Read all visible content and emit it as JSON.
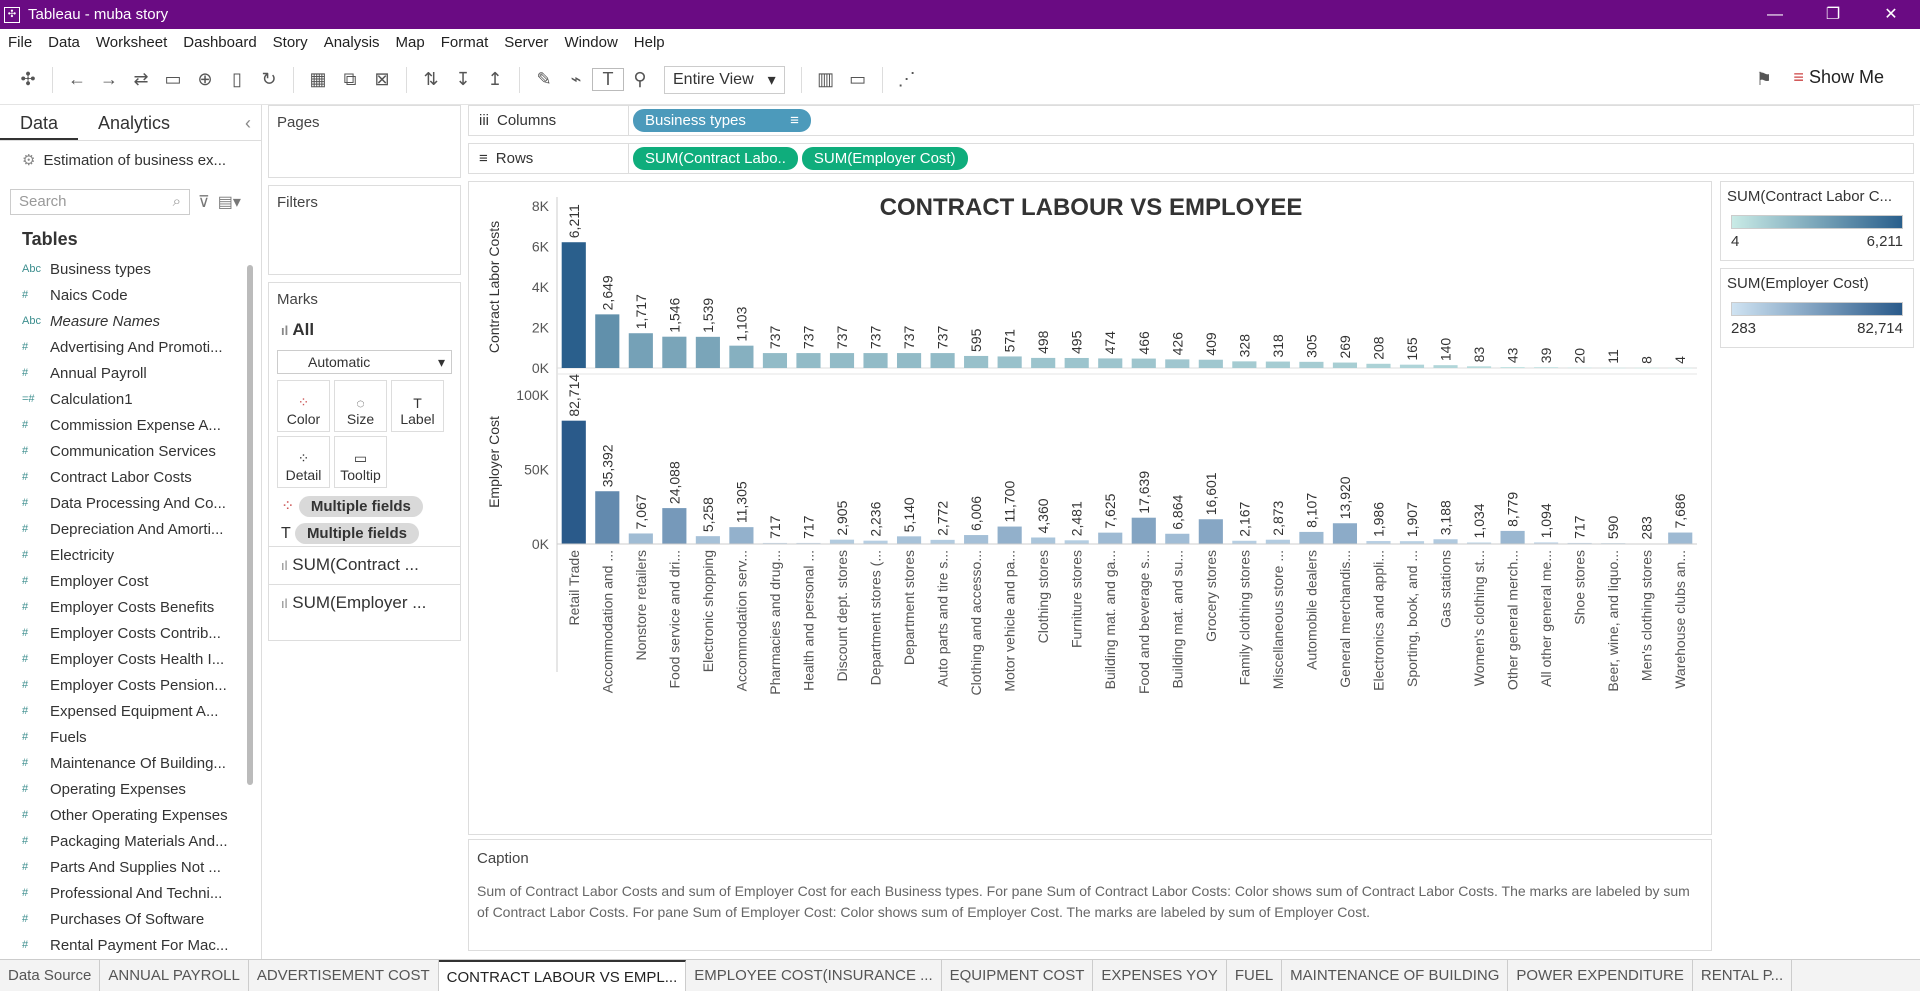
{
  "window": {
    "title": "Tableau - muba story"
  },
  "menu": [
    "File",
    "Data",
    "Worksheet",
    "Dashboard",
    "Story",
    "Analysis",
    "Map",
    "Format",
    "Server",
    "Window",
    "Help"
  ],
  "toolbar": {
    "fit": "Entire View",
    "showme": "Show Me"
  },
  "left": {
    "tabs": [
      "Data",
      "Analytics"
    ],
    "datasource": "Estimation of business ex...",
    "search_placeholder": "Search",
    "tables_heading": "Tables",
    "fields": [
      {
        "icon": "Abc",
        "label": "Business types"
      },
      {
        "icon": "#",
        "label": "Naics Code"
      },
      {
        "icon": "Abc",
        "label": "Measure Names",
        "italic": true
      },
      {
        "icon": "#",
        "label": "Advertising And Promoti..."
      },
      {
        "icon": "#",
        "label": "Annual Payroll"
      },
      {
        "icon": "=#",
        "label": "Calculation1"
      },
      {
        "icon": "#",
        "label": "Commission Expense A..."
      },
      {
        "icon": "#",
        "label": "Communication Services"
      },
      {
        "icon": "#",
        "label": "Contract Labor Costs"
      },
      {
        "icon": "#",
        "label": "Data Processing And Co..."
      },
      {
        "icon": "#",
        "label": "Depreciation And Amorti..."
      },
      {
        "icon": "#",
        "label": "Electricity"
      },
      {
        "icon": "#",
        "label": "Employer Cost"
      },
      {
        "icon": "#",
        "label": "Employer Costs Benefits"
      },
      {
        "icon": "#",
        "label": "Employer Costs Contrib..."
      },
      {
        "icon": "#",
        "label": "Employer Costs Health I..."
      },
      {
        "icon": "#",
        "label": "Employer Costs Pension..."
      },
      {
        "icon": "#",
        "label": "Expensed Equipment A..."
      },
      {
        "icon": "#",
        "label": "Fuels"
      },
      {
        "icon": "#",
        "label": "Maintenance Of Building..."
      },
      {
        "icon": "#",
        "label": "Operating Expenses"
      },
      {
        "icon": "#",
        "label": "Other Operating Expenses"
      },
      {
        "icon": "#",
        "label": "Packaging Materials And..."
      },
      {
        "icon": "#",
        "label": "Parts And Supplies Not ..."
      },
      {
        "icon": "#",
        "label": "Professional And Techni..."
      },
      {
        "icon": "#",
        "label": "Purchases Of Software"
      },
      {
        "icon": "#",
        "label": "Rental Payment For Mac..."
      }
    ]
  },
  "cards": {
    "pages": "Pages",
    "filters": "Filters",
    "marks": "Marks",
    "all": "All",
    "automatic": "Automatic",
    "buttons": [
      "Color",
      "Size",
      "Label",
      "Detail",
      "Tooltip"
    ],
    "multi": "Multiple fields",
    "measure1": "SUM(Contract ...",
    "measure2": "SUM(Employer ..."
  },
  "shelves": {
    "columns": "Columns",
    "rows": "Rows",
    "col_pill": "Business types",
    "row_pill1": "SUM(Contract Labo..",
    "row_pill2": "SUM(Employer Cost)"
  },
  "legends": [
    {
      "title": "SUM(Contract Labor C...",
      "min": "4",
      "max": "6,211",
      "c1": "#c9ebe6",
      "c2": "#2a5f8c"
    },
    {
      "title": "SUM(Employer Cost)",
      "min": "283",
      "max": "82,714",
      "c1": "#cfe3f2",
      "c2": "#2a5a8a"
    }
  ],
  "caption": {
    "title": "Caption",
    "text": "Sum of Contract Labor Costs and sum of Employer Cost for each Business types.  For pane Sum of Contract Labor Costs:  Color shows sum of Contract Labor Costs.  The marks are labeled by sum of Contract Labor Costs.  For pane Sum of Employer Cost:  Color shows sum of Employer Cost.  The marks are labeled by sum of Employer Cost."
  },
  "sheets": [
    "Data Source",
    "ANNUAL PAYROLL",
    "ADVERTISEMENT COST",
    "CONTRACT LABOUR VS EMPL...",
    "EMPLOYEE COST(INSURANCE ...",
    "EQUIPMENT COST",
    "EXPENSES YOY",
    "FUEL",
    "MAINTENANCE OF BUILDING",
    "POWER EXPENDITURE",
    "RENTAL P..."
  ],
  "chart_data": {
    "type": "bar",
    "title": "CONTRACT LABOUR VS EMPLOYEE",
    "categories": [
      "Retail Trade",
      "Accommodation and ...",
      "Nonstore retailers",
      "Food service and dri...",
      "Electronic shopping",
      "Accommodation serv...",
      "Pharmacies and drug...",
      "Health and personal ...",
      "Discount dept. stores",
      "Department stores (...",
      "Department stores",
      "Auto parts and tire s...",
      "Clothing and accesso...",
      "Motor vehicle and pa...",
      "Clothing stores",
      "Furniture stores",
      "Building mat. and ga...",
      "Food and beverage s...",
      "Building mat. and su...",
      "Grocery stores",
      "Family clothing stores",
      "Miscellaneous store ...",
      "Automobile dealers",
      "General merchandis...",
      "Electronics and appli...",
      "Sporting, book, and ...",
      "Gas stations",
      "Women's clothing st...",
      "Other general merch...",
      "All other general me...",
      "Shoe stores",
      "Beer, wine, and liquo...",
      "Men's clothing stores",
      "Warehouse clubs an..."
    ],
    "series": [
      {
        "name": "Contract Labor Costs",
        "axis_label": "Contract Labor Costs",
        "ylim": [
          0,
          8000
        ],
        "ticks": [
          "0K",
          "2K",
          "4K",
          "6K",
          "8K"
        ],
        "values": [
          6211,
          2649,
          1717,
          1546,
          1539,
          1103,
          737,
          737,
          737,
          737,
          737,
          737,
          595,
          571,
          498,
          495,
          474,
          466,
          426,
          409,
          328,
          318,
          305,
          269,
          208,
          165,
          140,
          83,
          43,
          39,
          20,
          11,
          8,
          4
        ],
        "labels": [
          "6,211",
          "2,649",
          "1,717",
          "1,546",
          "1,539",
          "1,103",
          "737",
          "737",
          "737",
          "737",
          "737",
          "737",
          "595",
          "571",
          "498",
          "495",
          "474",
          "466",
          "426",
          "409",
          "328",
          "318",
          "305",
          "269",
          "208",
          "165",
          "140",
          "83",
          "43",
          "39",
          "20",
          "11",
          "8",
          "4"
        ]
      },
      {
        "name": "Employer Cost",
        "axis_label": "Employer Cost",
        "ylim": [
          0,
          110000
        ],
        "ticks": [
          "0K",
          "50K",
          "100K"
        ],
        "values": [
          82714,
          35392,
          7067,
          24088,
          5258,
          11305,
          717,
          717,
          2905,
          2236,
          5140,
          2772,
          6006,
          11700,
          4360,
          2481,
          7625,
          17639,
          6864,
          16601,
          2167,
          2873,
          8107,
          13920,
          1986,
          1907,
          3188,
          1034,
          8779,
          1094,
          717,
          590,
          283,
          7686
        ],
        "labels": [
          "82,714",
          "35,392",
          "7,067",
          "24,088",
          "5,258",
          "11,305",
          "717",
          "717",
          "2,905",
          "2,236",
          "5,140",
          "2,772",
          "6,006",
          "11,700",
          "4,360",
          "2,481",
          "7,625",
          "17,639",
          "6,864",
          "16,601",
          "2,167",
          "2,873",
          "8,107",
          "13,920",
          "1,986",
          "1,907",
          "3,188",
          "1,034",
          "8,779",
          "1,094",
          "717",
          "590",
          "283",
          "7,686"
        ]
      }
    ]
  }
}
